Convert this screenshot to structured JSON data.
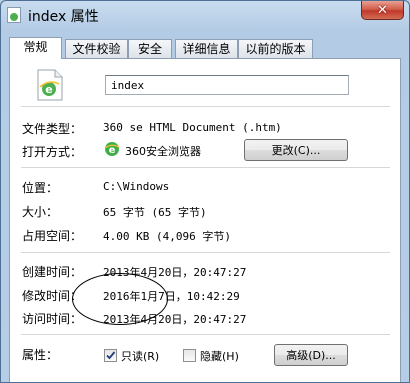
{
  "window": {
    "title": "index 属性",
    "close_glyph": "✕"
  },
  "tabs": [
    {
      "label": "常规",
      "active": true
    },
    {
      "label": "文件校验",
      "active": false
    },
    {
      "label": "安全",
      "active": false
    },
    {
      "label": "详细信息",
      "active": false
    },
    {
      "label": "以前的版本",
      "active": false
    }
  ],
  "general": {
    "filename": "index",
    "file_type": {
      "label": "文件类型：",
      "value": "360 se HTML Document (.htm)"
    },
    "opens_with": {
      "label": "打开方式：",
      "value": "360安全浏览器",
      "change_button": "更改(C)..."
    },
    "location": {
      "label": "位置：",
      "value": "C:\\Windows"
    },
    "size": {
      "label": "大小：",
      "value": "65 字节 (65 字节)"
    },
    "size_on_disk": {
      "label": "占用空间：",
      "value": "4.00 KB (4,096 字节)"
    },
    "created": {
      "label": "创建时间：",
      "value": "2013年4月20日，20:47:27"
    },
    "modified": {
      "label": "修改时间：",
      "value": "2016年1月7日，10:42:29"
    },
    "accessed": {
      "label": "访问时间：",
      "value": "2013年4月20日，20:47:27"
    },
    "attributes": {
      "label": "属性：",
      "readonly": {
        "label": "只读(R)",
        "checked": true
      },
      "hidden": {
        "label": "隐藏(H)",
        "checked": false
      },
      "advanced_button": "高级(D)..."
    }
  },
  "icons": {
    "title": "file-icon",
    "file": "ie-document-icon",
    "browser": "360-browser-icon",
    "check": "checkmark-icon"
  },
  "colors": {
    "close_button": "#c0392b",
    "chrome": "#b6cde6",
    "browser_icon": "#3fae49"
  }
}
